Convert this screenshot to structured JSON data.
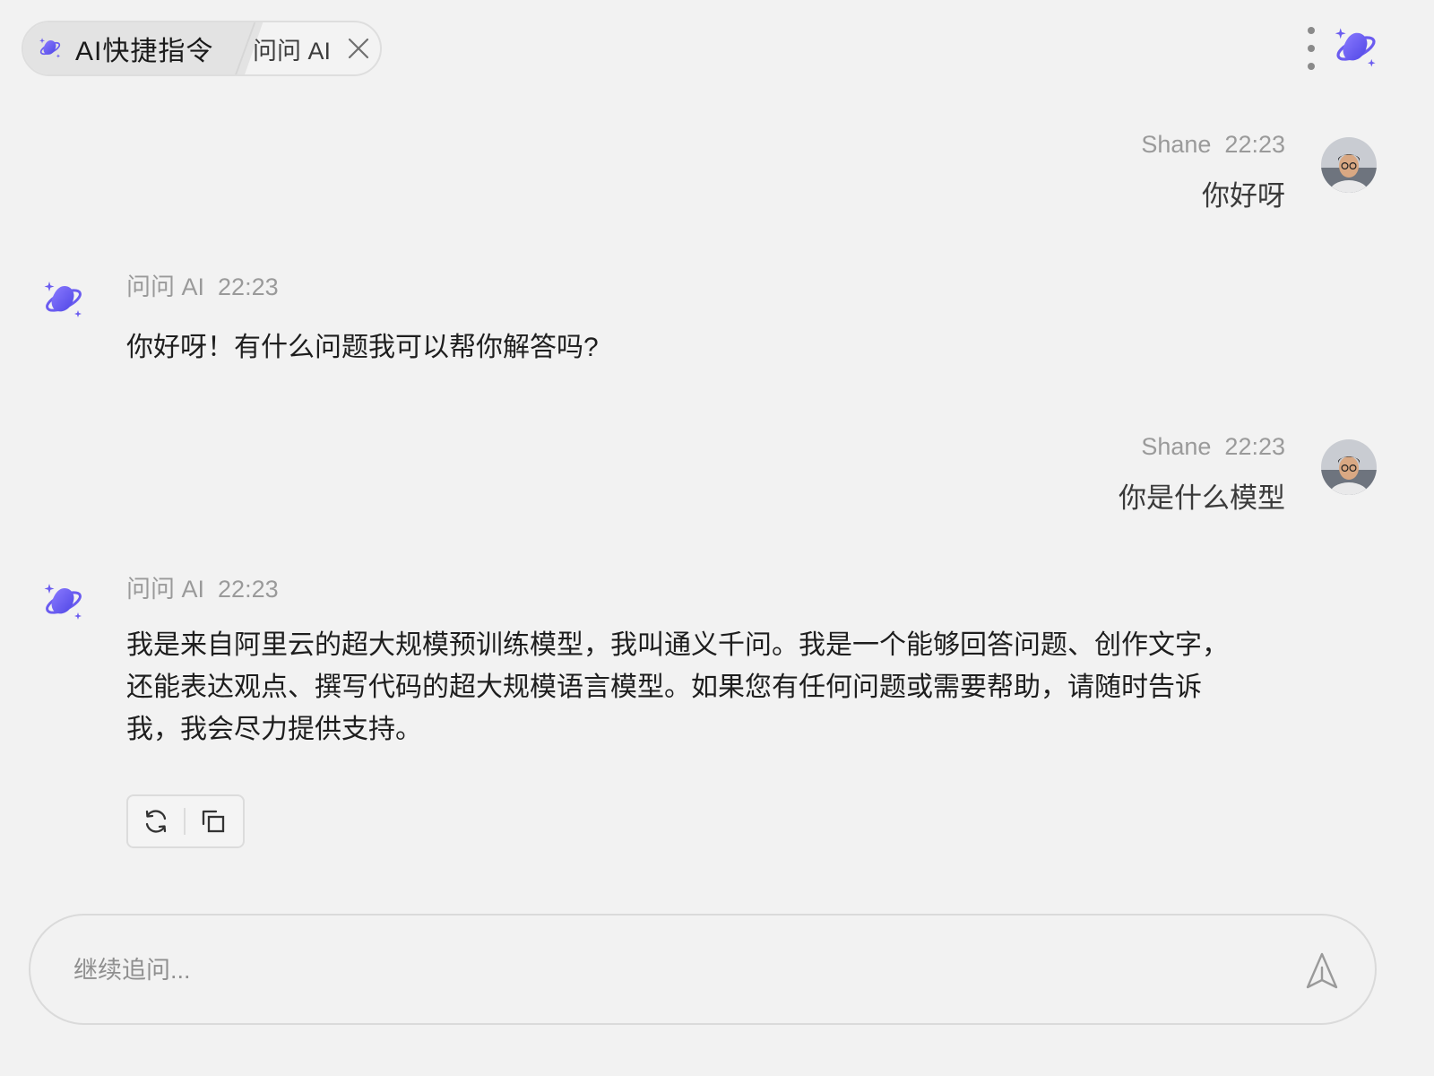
{
  "tabs": {
    "shortcut_label": "AI快捷指令",
    "ask_label": "问问 AI"
  },
  "colors": {
    "brand": "#6b5cf0",
    "background": "#f2f2f2"
  },
  "icons": {
    "tab_shortcut": "sparkle-planet-icon",
    "close": "close-icon",
    "more": "more-vertical-icon",
    "brand": "sparkle-planet-icon",
    "regenerate": "refresh-icon",
    "copy": "copy-icon",
    "send": "send-icon"
  },
  "messages": [
    {
      "role": "user",
      "sender": "Shane",
      "time": "22:23",
      "text": "你好呀"
    },
    {
      "role": "ai",
      "sender": "问问 AI",
      "time": "22:23",
      "text": "你好呀！有什么问题我可以帮你解答吗?"
    },
    {
      "role": "user",
      "sender": "Shane",
      "time": "22:23",
      "text": "你是什么模型"
    },
    {
      "role": "ai",
      "sender": "问问 AI",
      "time": "22:23",
      "lines": [
        "我是来自阿里云的超大规模预训练模型，我叫通义千问。我是一个能够回答问题、创作文字，",
        "还能表达观点、撰写代码的超大规模语言模型。如果您有任何问题或需要帮助，请随时告诉",
        "我，我会尽力提供支持。"
      ]
    }
  ],
  "composer": {
    "placeholder": "继续追问..."
  }
}
